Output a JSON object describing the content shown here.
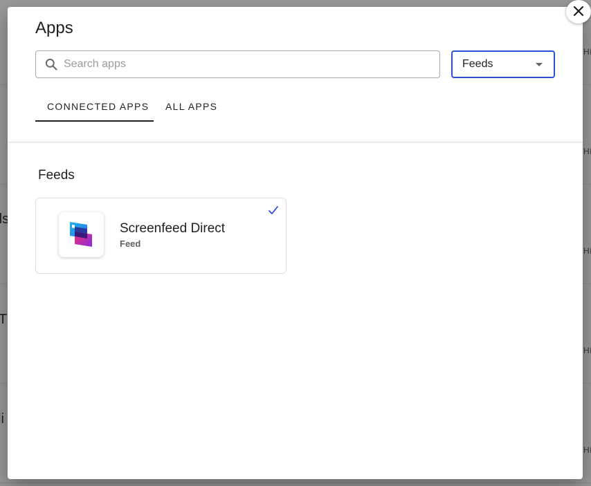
{
  "background": {
    "left_fragments": [
      "ds",
      "T",
      "li"
    ],
    "right_fragments": [
      "HI",
      "HI",
      "HI",
      "HI",
      "HI"
    ]
  },
  "modal": {
    "title": "Apps",
    "search": {
      "placeholder": "Search apps",
      "value": ""
    },
    "filter": {
      "selected": "Feeds"
    },
    "tabs": [
      {
        "label": "CONNECTED APPS",
        "active": true
      },
      {
        "label": "ALL APPS",
        "active": false
      }
    ],
    "section": {
      "title": "Feeds",
      "apps": [
        {
          "name": "Screenfeed Direct",
          "type": "Feed",
          "connected": true
        }
      ]
    }
  },
  "colors": {
    "accent": "#2d4fd1",
    "text": "#1f1f1f",
    "muted": "#5f5f5f"
  },
  "icons": {
    "search": "search-icon",
    "close": "close-icon",
    "check": "check-icon",
    "caret": "chevron-down-icon"
  }
}
